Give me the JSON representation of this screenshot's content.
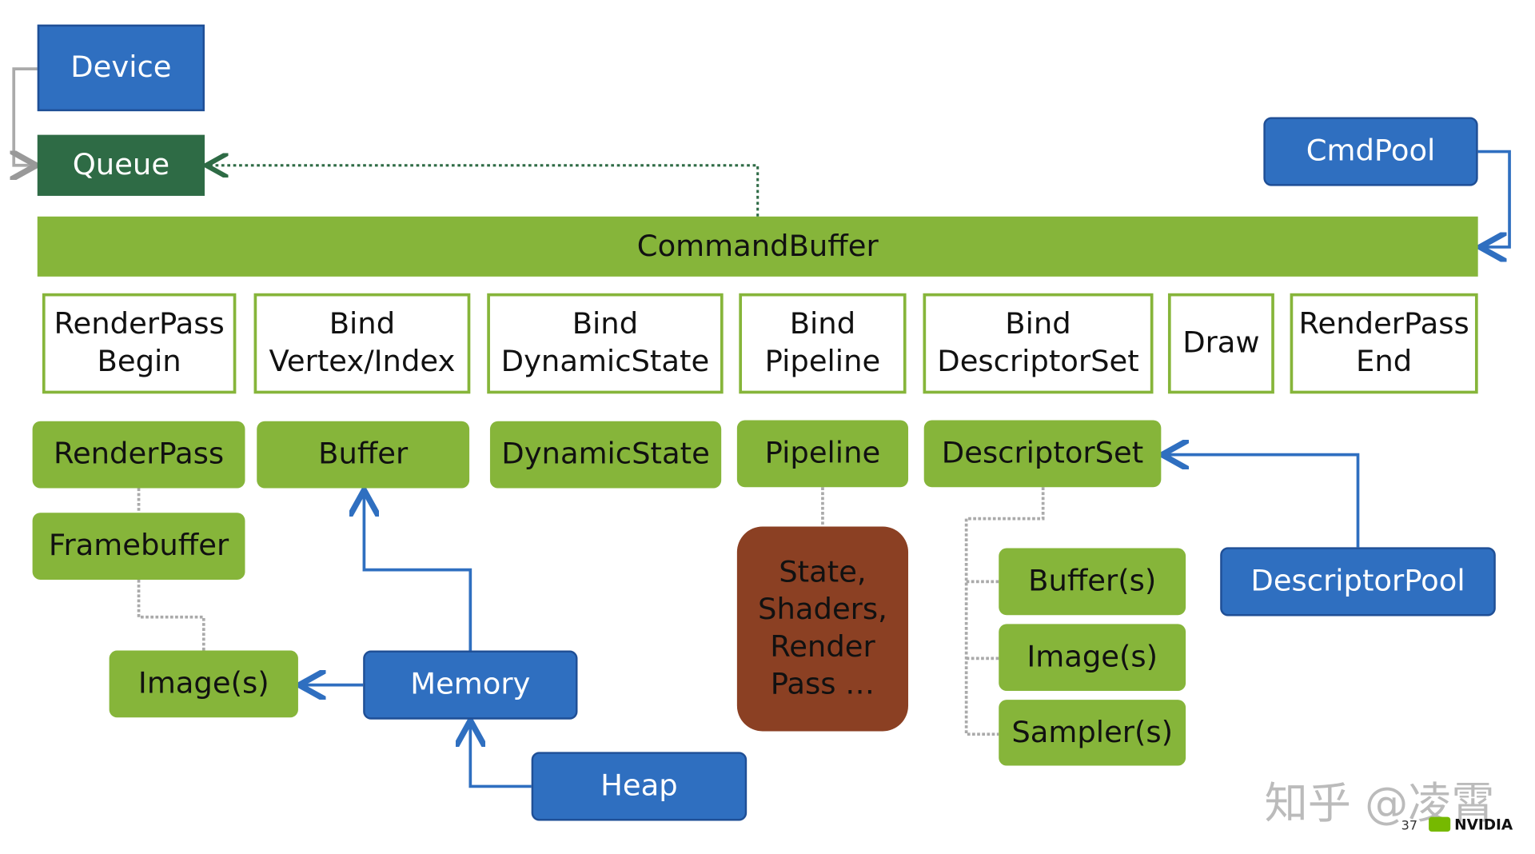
{
  "nodes": {
    "device": "Device",
    "queue": "Queue",
    "cmdpool": "CmdPool",
    "commandbuffer": "CommandBuffer",
    "rp_begin": "RenderPass\nBegin",
    "bind_vi": "Bind\nVertex/Index",
    "bind_ds": "Bind\nDynamicState",
    "bind_pipe": "Bind\nPipeline",
    "bind_dset": "Bind\nDescriptorSet",
    "draw": "Draw",
    "rp_end": "RenderPass\nEnd",
    "renderpass": "RenderPass",
    "buffer": "Buffer",
    "dynamicstate": "DynamicState",
    "pipeline": "Pipeline",
    "descriptorset": "DescriptorSet",
    "framebuffer": "Framebuffer",
    "images_left": "Image(s)",
    "memory": "Memory",
    "heap": "Heap",
    "state": "State,\nShaders,\nRender\nPass …",
    "buffers": "Buffer(s)",
    "images_right": "Image(s)",
    "samplers": "Sampler(s)",
    "descriptorpool": "DescriptorPool"
  },
  "footer": {
    "watermark": "知乎 @凌霄",
    "page_number": "37",
    "logo": "NVIDIA"
  },
  "colors": {
    "blue": "#2f6fc0",
    "green": "#86b53a",
    "dark_green": "#2e6b45",
    "brown": "#8b4023"
  }
}
